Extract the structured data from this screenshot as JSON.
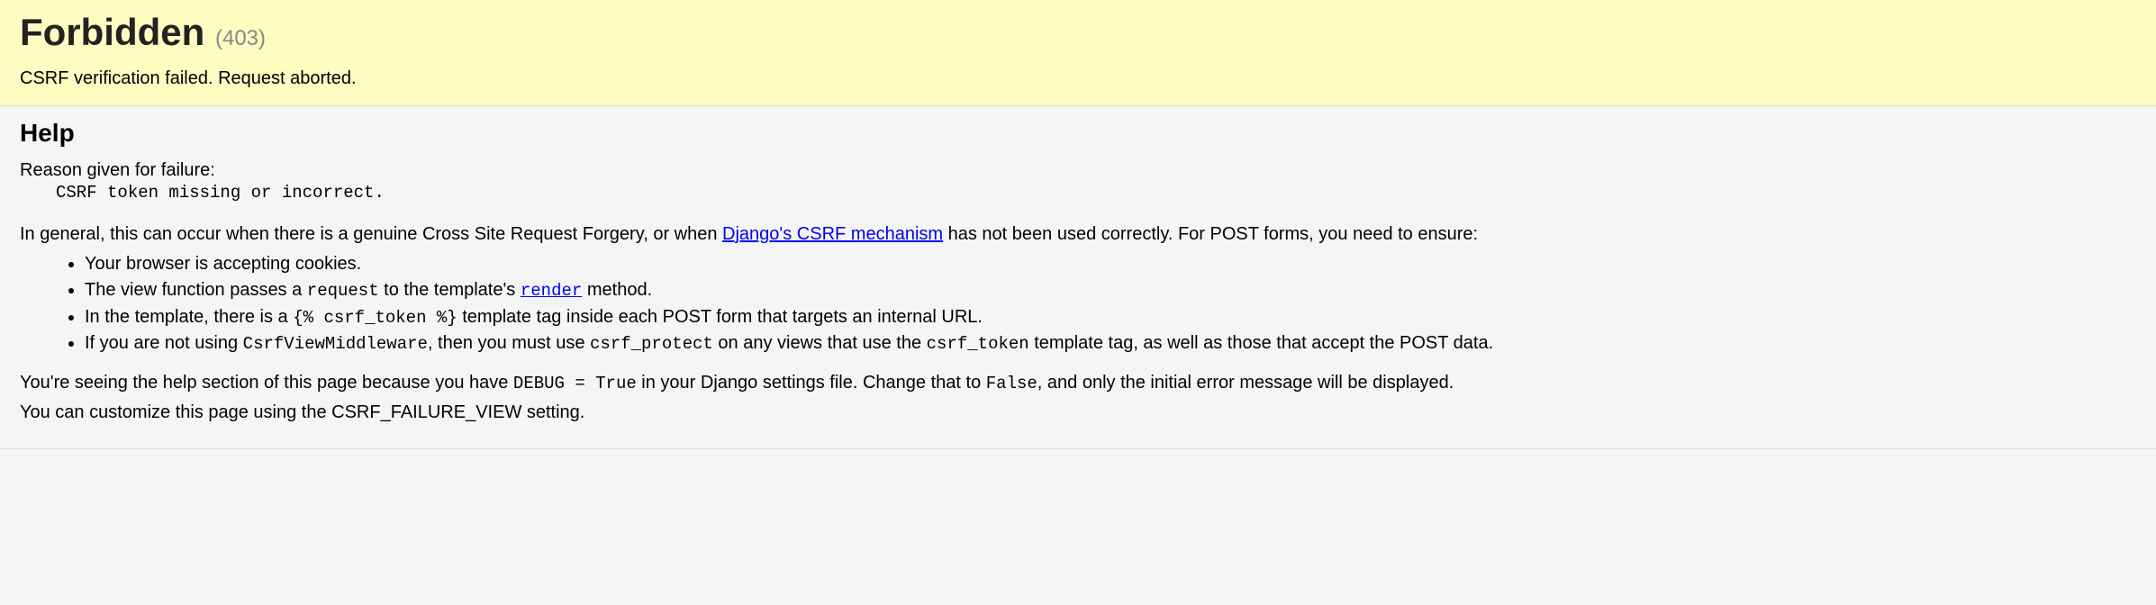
{
  "header": {
    "title": "Forbidden",
    "code": "(403)",
    "summary": "CSRF verification failed. Request aborted."
  },
  "help": {
    "heading": "Help",
    "reason_label": "Reason given for failure:",
    "reason_value": "CSRF token missing or incorrect.",
    "intro_pre": "In general, this can occur when there is a genuine Cross Site Request Forgery, or when ",
    "intro_link": "Django's CSRF mechanism",
    "intro_post": " has not been used correctly. For POST forms, you need to ensure:",
    "bullets": {
      "b0": "Your browser is accepting cookies.",
      "b1_pre": "The view function passes a ",
      "b1_code1": "request",
      "b1_mid": " to the template's ",
      "b1_link": "render",
      "b1_post": " method.",
      "b2_pre": "In the template, there is a ",
      "b2_code1": "{% csrf_token %}",
      "b2_post": " template tag inside each POST form that targets an internal URL.",
      "b3_pre": "If you are not using ",
      "b3_code1": "CsrfViewMiddleware",
      "b3_mid1": ", then you must use ",
      "b3_code2": "csrf_protect",
      "b3_mid2": " on any views that use the ",
      "b3_code3": "csrf_token",
      "b3_post": " template tag, as well as those that accept the POST data."
    },
    "debug_pre": "You're seeing the help section of this page because you have ",
    "debug_code1": "DEBUG = True",
    "debug_mid": " in your Django settings file. Change that to ",
    "debug_code2": "False",
    "debug_post": ", and only the initial error message will be displayed.",
    "customize": "You can customize this page using the CSRF_FAILURE_VIEW setting."
  }
}
